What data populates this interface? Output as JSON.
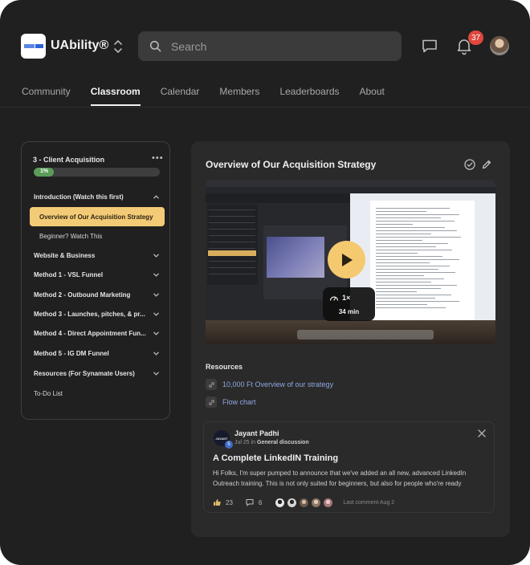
{
  "header": {
    "app_name": "UAbility®",
    "logo_text": "uability",
    "search_placeholder": "Search",
    "notification_count": "37",
    "icons": [
      "switcher-icon",
      "search-icon",
      "chat-icon",
      "bell-icon"
    ]
  },
  "nav": {
    "tabs": [
      {
        "label": "Community"
      },
      {
        "label": "Classroom"
      },
      {
        "label": "Calendar"
      },
      {
        "label": "Members"
      },
      {
        "label": "Leaderboards"
      },
      {
        "label": "About"
      }
    ],
    "active_tab": "Classroom"
  },
  "sidebar": {
    "course_title": "3 - Client Acquisition",
    "more_label": "•••",
    "progress_percent": 1,
    "progress_label": "1%",
    "modules": [
      {
        "label": "Introduction (Watch this first)",
        "expanded": true
      },
      {
        "label": "Website & Business",
        "expanded": false
      },
      {
        "label": "Method 1 - VSL Funnel",
        "expanded": false
      },
      {
        "label": "Method 2 - Outbound Marketing",
        "expanded": false
      },
      {
        "label": "Method 3 - Launches, pitches, & pr...",
        "expanded": false
      },
      {
        "label": "Method 4 - Direct Appointment Fun...",
        "expanded": false
      },
      {
        "label": "Method 5 - IG DM Funnel",
        "expanded": false
      },
      {
        "label": "Resources (For Synamate Users)",
        "expanded": false
      }
    ],
    "lessons": [
      {
        "label": "Overview of Our Acquisition Strategy",
        "active": true
      },
      {
        "label": "Beginner? Watch This",
        "active": false
      }
    ],
    "todo_label": "To-Do List"
  },
  "lesson": {
    "title": "Overview of Our Acquisition Strategy",
    "video": {
      "speed": "1×",
      "duration": "34 min"
    },
    "resources_title": "Resources",
    "resources": [
      {
        "label": "10,000 Ft Overview of our strategy"
      },
      {
        "label": "Flow chart"
      }
    ]
  },
  "post": {
    "avatar_text": "JAYANT",
    "level": "5",
    "author": "Jayant Padhi",
    "date": "Jul 25 in",
    "category": "General discussion",
    "title": "A Complete LinkedIN Training",
    "body": "Hi Folks, I'm super pumped to announce that we've added an all new, advanced LinkedIn Outreach training. This is not only suited for beginners, but also for people who're ready",
    "likes": "23",
    "comments": "6",
    "last_comment": "Last comment Aug 2",
    "commenter_colors": [
      "#e6e6e6",
      "#d6d6d6",
      "#c9b7a6",
      "#e2d2c7",
      "#e8d6d8"
    ]
  },
  "colors": {
    "accent": "#f4c96f",
    "progress": "#5a9c58",
    "link": "#8ea9e2",
    "badge": "#e0473d"
  }
}
